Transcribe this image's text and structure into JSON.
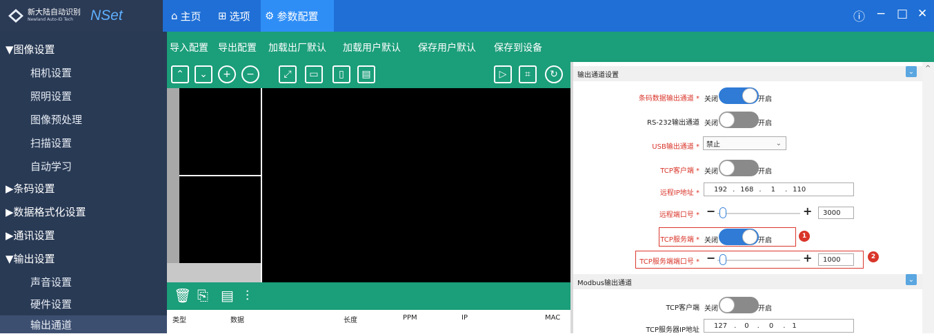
{
  "app": {
    "brand_cn": "新大陆自动识别",
    "brand_en": "Newland Auto-ID Tech",
    "product": "NSet"
  },
  "tabs": [
    {
      "label": "主页",
      "icon": "home-icon"
    },
    {
      "label": "选项",
      "icon": "grid-icon"
    },
    {
      "label": "参数配置",
      "icon": "gear-icon"
    }
  ],
  "window": {
    "info": "ⓘ",
    "minimize": "−",
    "maximize": "□",
    "close": "✕"
  },
  "sidebar": {
    "image_settings": "▼图像设置",
    "camera": "相机设置",
    "lighting": "照明设置",
    "preprocess": "图像预处理",
    "scan": "扫描设置",
    "autolearn": "自动学习",
    "barcode": "▶条码设置",
    "format": "▶数据格式化设置",
    "comm": "▶通讯设置",
    "output": "▼输出设置",
    "sound": "声音设置",
    "hardware": "硬件设置",
    "channel": "输出通道"
  },
  "actions": [
    "导入配置",
    "导出配置",
    "加载出厂默认",
    "加载用户默认",
    "保存用户默认",
    "保存到设备"
  ],
  "list": {
    "cols": [
      "类型",
      "数据",
      "长度",
      "PPM",
      "IP",
      "MAC"
    ]
  },
  "output_section": {
    "title": "输出通道设置",
    "barcode_out": "条码数据输出通道 *",
    "rs232": "RS-232输出通道",
    "usb": "USB输出通道 *",
    "usb_value": "禁止",
    "tcp_client": "TCP客户端 *",
    "remote_ip": "远程IP地址 *",
    "remote_ip_parts": [
      "192",
      ".",
      "168",
      ".",
      "1",
      ".",
      "110"
    ],
    "remote_port": "远程端口号 *",
    "remote_port_value": "3000",
    "tcp_server": "TCP服务端 *",
    "tcp_server_port": "TCP服务端端口号 *",
    "tcp_server_port_value": "1000",
    "off": "关闭",
    "on": "开启"
  },
  "modbus_section": {
    "title": "Modbus输出通道",
    "tcp_client": "TCP客户端",
    "server_ip": "TCP服务器IP地址",
    "server_ip_parts": [
      "127",
      ".",
      "0",
      ".",
      "0",
      ".",
      "1"
    ]
  },
  "badges": [
    "1",
    "2"
  ],
  "colors": {
    "topbar": "#1f6fd6",
    "sidebar": "#293a55",
    "toolbar": "#1b9e7a",
    "toggle_on": "#2f7bd6",
    "accent_red": "#d9352a"
  }
}
